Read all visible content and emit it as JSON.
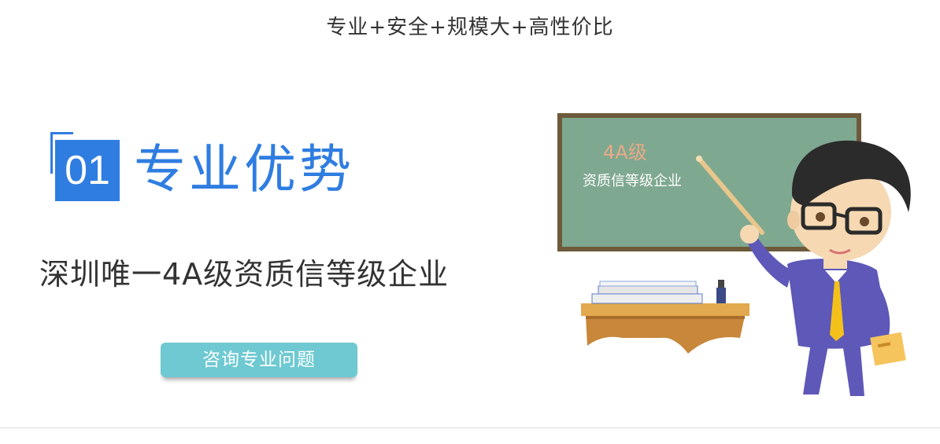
{
  "header": {
    "tagline": "专业+安全+规模大+高性价比"
  },
  "feature": {
    "number": "01",
    "title": "专业优势",
    "subtitle": "深圳唯一4A级资质信等级企业",
    "button_label": "咨询专业问题"
  },
  "illustration": {
    "board_line1": "4A级",
    "board_line2": "资质信等级企业"
  },
  "colors": {
    "accent_blue": "#2f7de1",
    "button_teal": "#6ec9d2",
    "board_green": "#7fa890",
    "text_dark": "#333333"
  }
}
